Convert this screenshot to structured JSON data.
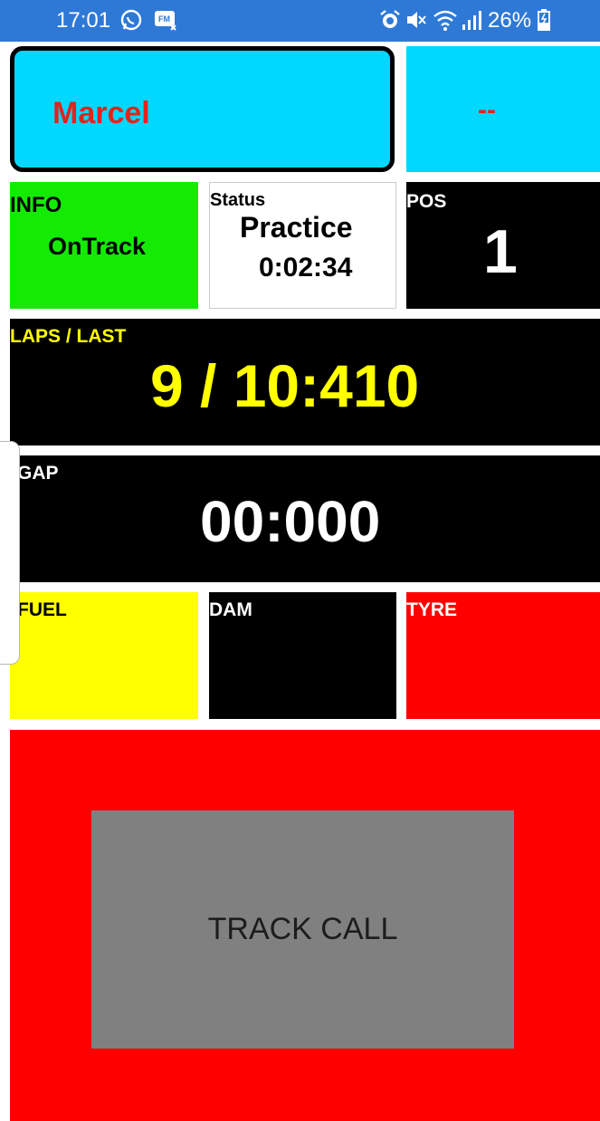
{
  "status_bar": {
    "time": "17:01",
    "left_icons": [
      "whatsapp-icon",
      "fm-radio-icon"
    ],
    "right_icons": [
      "alarm-icon",
      "mute-icon",
      "wifi-icon",
      "signal-icon"
    ],
    "battery": "26%"
  },
  "driver": {
    "name": "Marcel"
  },
  "secondary": {
    "value": "--"
  },
  "info": {
    "label": "INFO",
    "value": "OnTrack"
  },
  "status": {
    "label": "Status",
    "session": "Practice",
    "time": "0:02:34"
  },
  "position": {
    "label": "POS",
    "value": "1"
  },
  "laps": {
    "label": "LAPS / LAST",
    "value": "9 / 10:410"
  },
  "gap": {
    "label": "GAP",
    "value": "00:000"
  },
  "fuel": {
    "label": "FUEL"
  },
  "damage": {
    "label": "DAM"
  },
  "tyre": {
    "label": "TYRE"
  },
  "actions": {
    "track_call": "TRACK CALL"
  },
  "colors": {
    "driver_bg": "#00d8ff",
    "driver_text": "#e1251b",
    "info_bg": "#14eb05",
    "laps_text": "#ffff00",
    "fuel_bg": "#ffff00",
    "tyre_bg": "#ff0000",
    "call_bg": "#ff0000",
    "call_button": "#808080"
  }
}
